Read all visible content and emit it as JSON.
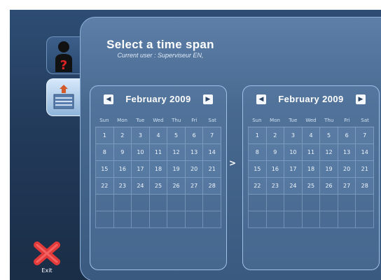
{
  "header": {
    "title": "Select a time span",
    "subtitle": "Current user : Superviseur EN,"
  },
  "rail": {
    "tabs": [
      {
        "icon": "user-unknown-icon"
      },
      {
        "icon": "calendar-icon"
      }
    ],
    "exit": {
      "label": "Exit",
      "icon": "exit-x-icon"
    }
  },
  "separator": ">",
  "calendars": {
    "start": {
      "month_label": "February 2009",
      "weekdays": [
        "Sun",
        "Mon",
        "Tue",
        "Wed",
        "Thu",
        "Fri",
        "Sat"
      ],
      "days": [
        "1",
        "2",
        "3",
        "4",
        "5",
        "6",
        "7",
        "8",
        "9",
        "10",
        "11",
        "12",
        "13",
        "14",
        "15",
        "16",
        "17",
        "18",
        "19",
        "20",
        "21",
        "22",
        "23",
        "24",
        "25",
        "26",
        "27",
        "28",
        "",
        "",
        "",
        "",
        "",
        "",
        "",
        "",
        "",
        "",
        "",
        "",
        "",
        ""
      ]
    },
    "end": {
      "month_label": "February 2009",
      "weekdays": [
        "Sun",
        "Mon",
        "Tue",
        "Wed",
        "Thu",
        "Fri",
        "Sat"
      ],
      "days": [
        "1",
        "2",
        "3",
        "4",
        "5",
        "6",
        "7",
        "8",
        "9",
        "10",
        "11",
        "12",
        "13",
        "14",
        "15",
        "16",
        "17",
        "18",
        "19",
        "20",
        "21",
        "22",
        "23",
        "24",
        "25",
        "26",
        "27",
        "28",
        "",
        "",
        "",
        "",
        "",
        "",
        "",
        "",
        "",
        "",
        "",
        "",
        "",
        ""
      ]
    }
  },
  "colors": {
    "background": "#223a5a",
    "panel": "#48698f",
    "accent": "#9ec1e6",
    "exit": "#e23a3a"
  }
}
